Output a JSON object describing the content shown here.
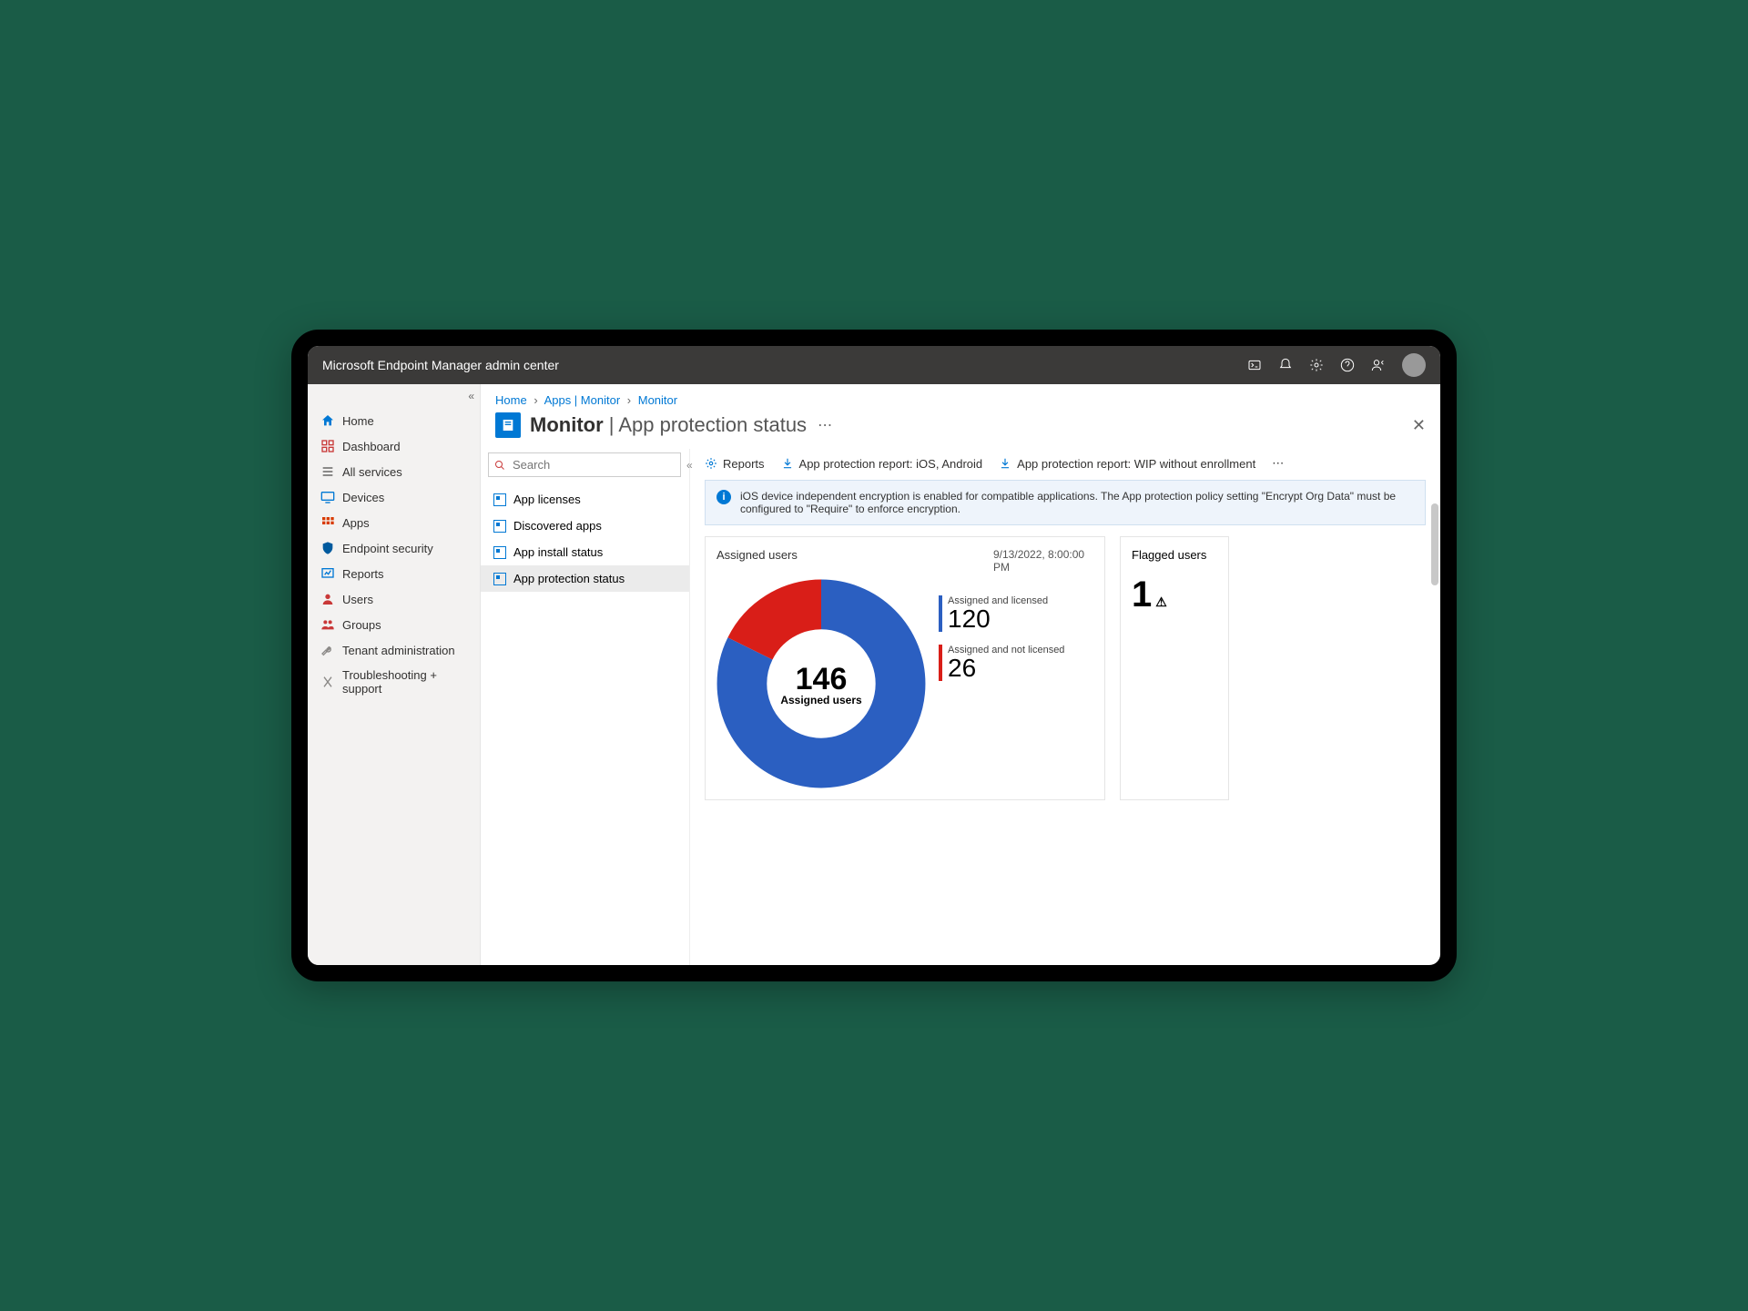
{
  "header": {
    "title": "Microsoft Endpoint Manager admin center"
  },
  "sidebar": {
    "items": [
      {
        "label": "Home"
      },
      {
        "label": "Dashboard"
      },
      {
        "label": "All services"
      },
      {
        "label": "Devices"
      },
      {
        "label": "Apps"
      },
      {
        "label": "Endpoint security"
      },
      {
        "label": "Reports"
      },
      {
        "label": "Users"
      },
      {
        "label": "Groups"
      },
      {
        "label": "Tenant administration"
      },
      {
        "label": "Troubleshooting + support"
      }
    ]
  },
  "breadcrumb": {
    "a": "Home",
    "b": "Apps | Monitor",
    "c": "Monitor"
  },
  "page": {
    "title_strong": "Monitor",
    "title_rest": " | App protection status"
  },
  "search": {
    "placeholder": "Search"
  },
  "subnav": {
    "items": [
      {
        "label": "App licenses"
      },
      {
        "label": "Discovered apps"
      },
      {
        "label": "App install status"
      },
      {
        "label": "App protection status"
      }
    ]
  },
  "toolbar": {
    "reports": "Reports",
    "r1": "App protection report: iOS, Android",
    "r2": "App protection report: WIP without enrollment"
  },
  "info": "iOS device independent encryption is enabled for compatible applications. The App protection policy setting \"Encrypt Org Data\" must be configured to \"Require\" to enforce encryption.",
  "assigned": {
    "title": "Assigned users",
    "timestamp": "9/13/2022, 8:00:00 PM",
    "total": "146",
    "total_label": "Assigned users",
    "licensed_label": "Assigned and licensed",
    "licensed": "120",
    "unlicensed_label": "Assigned and not licensed",
    "unlicensed": "26"
  },
  "flagged": {
    "title": "Flagged users",
    "value": "1"
  },
  "chart_data": {
    "type": "pie",
    "title": "Assigned users",
    "total": 146,
    "series": [
      {
        "name": "Assigned and licensed",
        "value": 120,
        "color": "#2b5fc1"
      },
      {
        "name": "Assigned and not licensed",
        "value": 26,
        "color": "#d91e18"
      }
    ]
  },
  "colors": {
    "blue": "#2b5fc1",
    "red": "#d91e18"
  }
}
